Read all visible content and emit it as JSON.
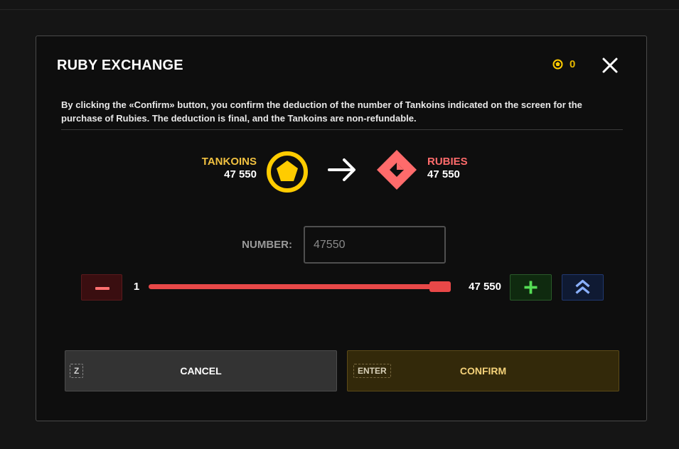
{
  "dialog": {
    "title": "RUBY EXCHANGE",
    "balance": "0",
    "description": "By clicking the «Confirm» button, you confirm the deduction of the number of Tankoins indicated on the screen for the purchase of Rubies. The deduction is final, and the Tankoins are non-refundable."
  },
  "exchange": {
    "from_label": "TANKOINS",
    "from_amount": "47 550",
    "to_label": "RUBIES",
    "to_amount": "47 550"
  },
  "number": {
    "label": "NUMBER:",
    "placeholder": "47550"
  },
  "slider": {
    "min_label": "1",
    "max_label": "47 550",
    "fraction": 1.0
  },
  "buttons": {
    "cancel_hotkey": "Z",
    "cancel_label": "CANCEL",
    "confirm_hotkey": "ENTER",
    "confirm_label": "CONFIRM"
  },
  "icons": {
    "balance": "tankoin-icon",
    "close": "close-icon",
    "from": "tankoin-icon",
    "arrow": "arrow-right-icon",
    "to": "ruby-icon",
    "minus": "minus-icon",
    "plus": "plus-icon",
    "max": "double-chevron-up-icon"
  },
  "colors": {
    "tankoin": "#ffcc00",
    "ruby": "#ff6b6b",
    "slider": "#e84848",
    "plus": "#55dd55",
    "max": "#8ab0ff"
  }
}
